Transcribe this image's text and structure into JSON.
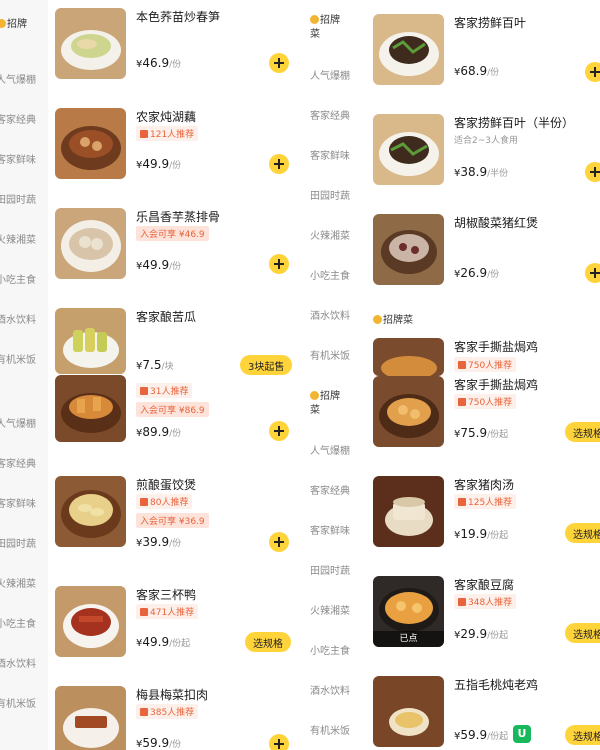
{
  "left_pane": {
    "categories": [
      {
        "label": "招牌",
        "label2": "",
        "icon": "coin-icon"
      },
      {
        "label": "人气爆棚"
      },
      {
        "label": "客家经典"
      },
      {
        "label": "客家鲜味"
      },
      {
        "label": "田园时蔬"
      },
      {
        "label": "火辣湘菜"
      },
      {
        "label": "小吃主食"
      },
      {
        "label": "酒水饮料"
      },
      {
        "label": "有机米饭"
      },
      {
        "label": "人气爆棚"
      },
      {
        "label": "客家经典"
      },
      {
        "label": "客家鲜味"
      },
      {
        "label": "田园时蔬"
      },
      {
        "label": "火辣湘菜"
      },
      {
        "label": "小吃主食"
      },
      {
        "label": "酒水饮料"
      },
      {
        "label": "有机米饭"
      }
    ],
    "items": [
      {
        "name": "本色荞苗炒春笋",
        "price": "46.9",
        "unit": "/份"
      },
      {
        "name": "农家炖湖藕",
        "badge": "121人推荐",
        "price": "49.9",
        "unit": "/份"
      },
      {
        "name": "乐昌香芋蒸排骨",
        "promo": "入会可享 ¥46.9",
        "price": "49.9",
        "unit": "/份"
      },
      {
        "name": "客家酿苦瓜",
        "price": "7.5",
        "unit": "/块",
        "button": "3块起售"
      },
      {
        "badge": "31人推荐",
        "promo": "入会可享 ¥86.9",
        "price": "89.9",
        "unit": "/份"
      },
      {
        "name": "煎酿蛋饺煲",
        "badge": "80人推荐",
        "promo": "入会可享 ¥36.9",
        "price": "39.9",
        "unit": "/份"
      },
      {
        "name": "客家三杯鸭",
        "badge": "471人推荐",
        "price": "49.9",
        "unit": "/份起",
        "button": "选规格"
      },
      {
        "name": "梅县梅菜扣肉",
        "badge": "385人推荐",
        "price": "59.9",
        "unit": "/份"
      }
    ]
  },
  "right_pane": {
    "categories": [
      {
        "label": "招牌",
        "label2": "菜",
        "icon": "coin-icon"
      },
      {
        "label": "人气爆棚"
      },
      {
        "label": "客家经典"
      },
      {
        "label": "客家鲜味"
      },
      {
        "label": "田园时蔬"
      },
      {
        "label": "火辣湘菜"
      },
      {
        "label": "小吃主食"
      },
      {
        "label": "酒水饮料"
      },
      {
        "label": "有机米饭"
      },
      {
        "label": "招牌",
        "label2": "菜",
        "icon": "coin-icon"
      },
      {
        "label": "人气爆棚"
      },
      {
        "label": "客家经典"
      },
      {
        "label": "客家鲜味"
      },
      {
        "label": "田园时蔬"
      },
      {
        "label": "火辣湘菜"
      },
      {
        "label": "小吃主食"
      },
      {
        "label": "酒水饮料"
      },
      {
        "label": "有机米饭"
      }
    ],
    "section_header": "招牌菜",
    "items": [
      {
        "name": "客家捞鲜百叶",
        "price": "68.9",
        "unit": "/份"
      },
      {
        "name": "客家捞鲜百叶（半份）",
        "sub": "适合2~3人食用",
        "price": "38.9",
        "unit": "/半份"
      },
      {
        "name": "胡椒酸菜猪红煲",
        "price": "26.9",
        "unit": "/份"
      },
      {
        "name": "客家手撕盐焗鸡",
        "badge": "750人推荐"
      },
      {
        "name": "客家手撕盐焗鸡",
        "badge": "750人推荐",
        "price": "75.9",
        "unit": "/份起",
        "button": "选规格"
      },
      {
        "name": "客家猪肉汤",
        "badge": "125人推荐",
        "price": "19.9",
        "unit": "/份起",
        "button": "选规格"
      },
      {
        "name": "客家酿豆腐",
        "badge": "348人推荐",
        "price": "29.9",
        "unit": "/份起",
        "button": "选规格",
        "overlay": "已点"
      },
      {
        "name": "五指毛桃炖老鸡",
        "price": "59.9",
        "unit": "/份起",
        "button": "选规格",
        "logo": "U"
      }
    ]
  },
  "currency_symbol": "¥",
  "colors": {
    "accent": "#ffd43b",
    "badge_text": "#e8643c",
    "badge_bg": "#fdf0ea",
    "sidebar_bg": "#f7f7f7"
  }
}
